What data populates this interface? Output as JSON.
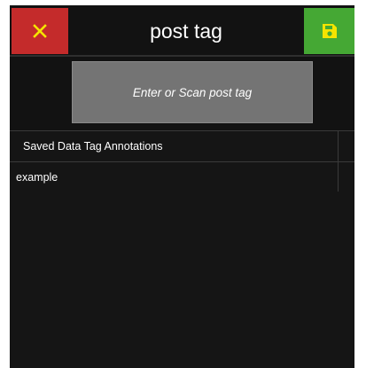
{
  "header": {
    "title": "post tag",
    "close_icon": "close-x-icon",
    "save_icon": "floppy-disk-icon",
    "close_color": "#c42b2b",
    "save_color": "#45a834",
    "icon_color": "#f5e400"
  },
  "scan_field": {
    "placeholder": "Enter or Scan post tag"
  },
  "table": {
    "column_header": "Saved Data Tag Annotations",
    "rows": [
      "example"
    ]
  }
}
